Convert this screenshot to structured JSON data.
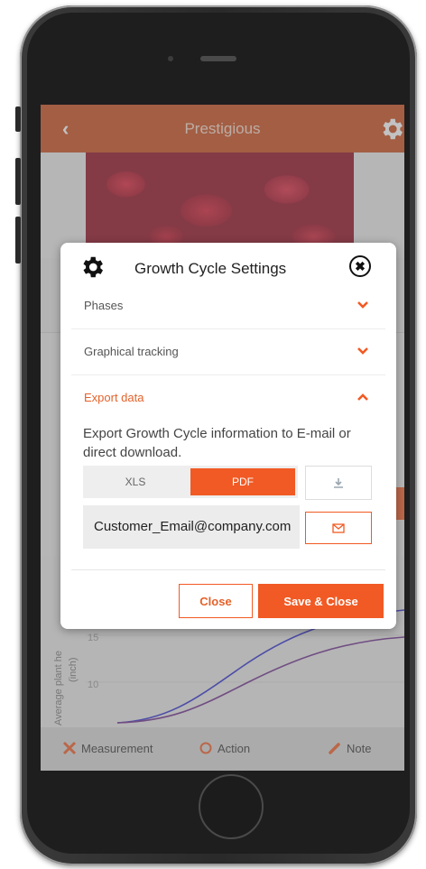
{
  "header": {
    "back_icon": "chevron-left-icon",
    "title": "Prestigious",
    "settings_icon": "gear-icon"
  },
  "dialog": {
    "title": "Growth Cycle Settings",
    "sections": [
      {
        "label": "Phases",
        "expanded": false
      },
      {
        "label": "Graphical tracking",
        "expanded": false
      },
      {
        "label": "Export data",
        "expanded": true
      }
    ],
    "export_description": "Export Growth Cycle information to E-mail or direct download.",
    "formats": [
      {
        "label": "XLS",
        "selected": false
      },
      {
        "label": "PDF",
        "selected": true
      }
    ],
    "download_icon": "download-icon",
    "email_value": "Customer_Email@company.com",
    "mail_icon": "mail-icon",
    "close_label": "Close",
    "save_label": "Save & Close"
  },
  "chart": {
    "ylabel": "Average plant he",
    "yunit": "(inch)",
    "ticks": [
      "15",
      "10"
    ]
  },
  "bottom_nav": [
    {
      "label": "Measurement",
      "icon": "measurement-icon"
    },
    {
      "label": "Action",
      "icon": "refresh-icon"
    },
    {
      "label": "Note",
      "icon": "pencil-icon"
    }
  ],
  "colors": {
    "accent": "#f15a24",
    "header": "#c7491a"
  }
}
